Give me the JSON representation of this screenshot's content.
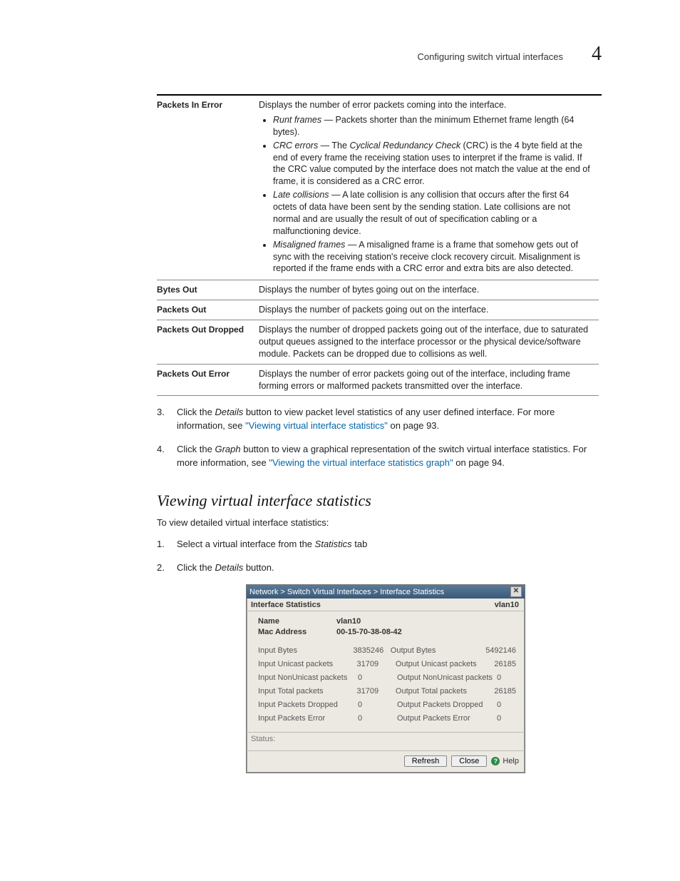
{
  "header": {
    "running_title": "Configuring switch virtual interfaces",
    "chapter_number": "4"
  },
  "defs": [
    {
      "term": "Packets In Error",
      "intro": "Displays the number of error packets coming into the interface.",
      "bullets": [
        {
          "lead": "Runt frames",
          "rest": " — Packets shorter than the minimum Ethernet frame length (64 bytes)."
        },
        {
          "lead": "CRC errors",
          "rest": " — The Cyclical Redundancy Check (CRC) is the 4 byte field at the end of every frame the receiving station uses to interpret if the frame is valid. If the CRC value computed by the interface does not match the value at the end of frame, it is considered as a CRC error.",
          "em_inner": "Cyclical Redundancy Check"
        },
        {
          "lead": "Late collisions",
          "rest": " — A late collision is any collision that occurs after the first 64 octets of data have been sent by the sending station. Late collisions are not normal and are usually the result of out of specification cabling or a malfunctioning device."
        },
        {
          "lead": "Misaligned frames",
          "rest": " — A misaligned frame is a frame that somehow gets out of sync with the receiving station's receive clock recovery circuit. Misalignment is reported if the frame ends with a CRC error and extra bits are also detected."
        }
      ]
    },
    {
      "term": "Bytes Out",
      "desc": "Displays the number of bytes going out on the interface."
    },
    {
      "term": "Packets Out",
      "desc": "Displays the number of packets going out on the interface."
    },
    {
      "term": "Packets Out Dropped",
      "desc": "Displays the number of dropped packets going out of the interface, due to saturated output queues assigned to the interface processor or the physical device/software module. Packets can be dropped due to collisions as well."
    },
    {
      "term": "Packets Out Error",
      "desc": "Displays the number of error packets going out of the interface, including frame forming errors or malformed packets transmitted over the interface."
    }
  ],
  "steps_a": [
    {
      "num": "3.",
      "pre": "Click the ",
      "em": "Details",
      "mid": " button to view packet level statistics of any user defined interface. For more information, see ",
      "link": "\"Viewing virtual interface statistics\"",
      "post": " on page 93."
    },
    {
      "num": "4.",
      "pre": "Click the ",
      "em": "Graph",
      "mid": " button to view a graphical representation of the switch virtual interface statistics. For more information, see ",
      "link": "\"Viewing the virtual interface statistics graph\"",
      "post": " on page 94."
    }
  ],
  "section_title": "Viewing virtual interface statistics",
  "intro_line": "To view detailed virtual interface statistics:",
  "steps_b": [
    {
      "num": "1.",
      "pre": "Select a virtual interface from the ",
      "em": "Statistics",
      "post": " tab"
    },
    {
      "num": "2.",
      "pre": "Click the ",
      "em": "Details",
      "post": " button."
    }
  ],
  "dialog": {
    "breadcrumb": "Network > Switch Virtual Interfaces > Interface Statistics",
    "close_glyph": "✕",
    "subtitle_left": "Interface Statistics",
    "subtitle_right": "vlan10",
    "info": {
      "name_label": "Name",
      "name_value": "vlan10",
      "mac_label": "Mac Address",
      "mac_value": "00-15-70-38-08-42"
    },
    "stats": [
      {
        "l1": "Input Bytes",
        "v1": "3835246",
        "l2": "Output Bytes",
        "v2": "5492146"
      },
      {
        "l1": "Input Unicast packets",
        "v1": "31709",
        "l2": "Output Unicast packets",
        "v2": "26185"
      },
      {
        "l1": "Input NonUnicast packets",
        "v1": "0",
        "l2": "Output NonUnicast packets",
        "v2": "0"
      },
      {
        "l1": "Input Total packets",
        "v1": "31709",
        "l2": "Output Total packets",
        "v2": "26185"
      },
      {
        "l1": "Input Packets Dropped",
        "v1": "0",
        "l2": "Output Packets Dropped",
        "v2": "0"
      },
      {
        "l1": "Input Packets Error",
        "v1": "0",
        "l2": "Output Packets Error",
        "v2": "0"
      }
    ],
    "status_label": "Status:",
    "buttons": {
      "refresh": "Refresh",
      "close": "Close",
      "help": "Help"
    }
  }
}
